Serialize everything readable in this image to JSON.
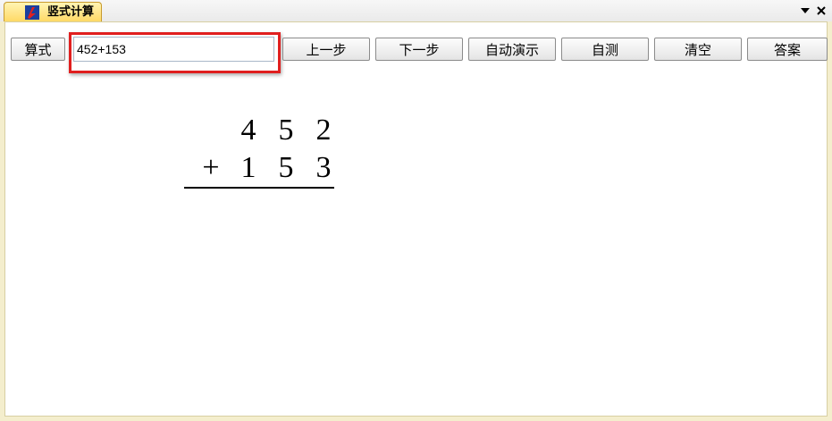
{
  "tab": {
    "title": "竖式计算"
  },
  "toolbar": {
    "expression_button": "算式",
    "expression_value": "452+153",
    "prev_button": "上一步",
    "next_button": "下一步",
    "auto_demo_button": "自动演示",
    "self_test_button": "自测",
    "clear_button": "清空",
    "answer_button": "答案"
  },
  "calculation": {
    "row1": [
      "4",
      "5",
      "2"
    ],
    "operator": "+",
    "row2": [
      "1",
      "5",
      "3"
    ]
  },
  "colors": {
    "tab_fill": "#ffd966",
    "frame": "#f4eecd",
    "highlight": "#e01f1f"
  },
  "icons": {
    "tab": "app-logo-icon",
    "window_controls": [
      "dropdown-arrow-icon",
      "close-icon"
    ]
  }
}
